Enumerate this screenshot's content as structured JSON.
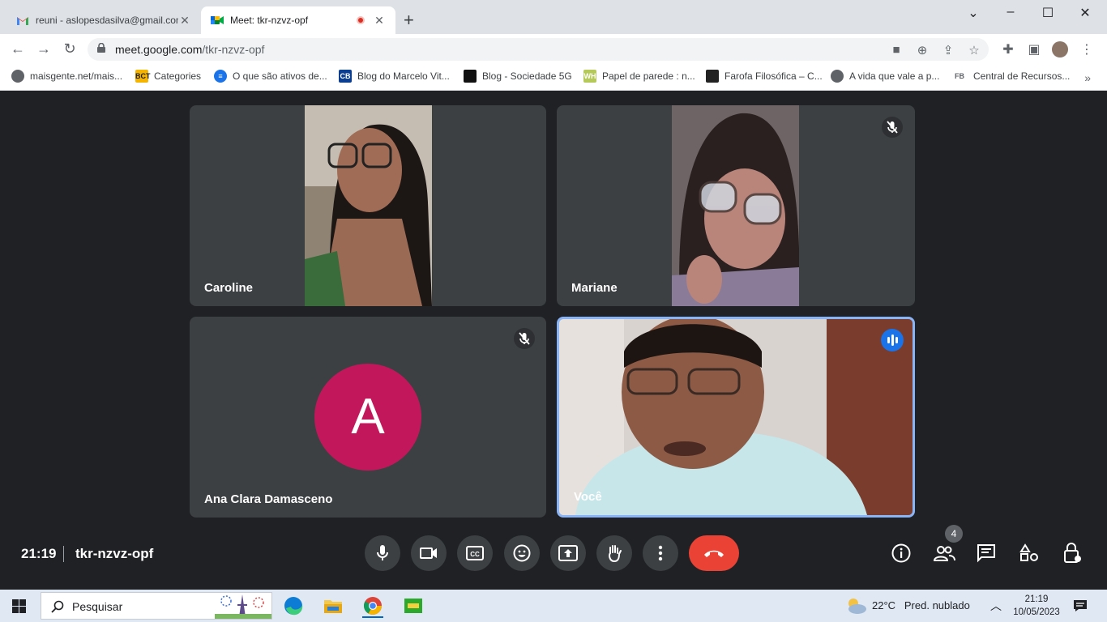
{
  "browser": {
    "tabs": [
      {
        "title": "reuni - aslopesdasilva@gmail.com",
        "active": false
      },
      {
        "title": "Meet: tkr-nzvz-opf",
        "active": true
      }
    ],
    "url_host": "meet.google.com",
    "url_path": "/tkr-nzvz-opf",
    "bookmarks": [
      {
        "label": "maisgente.net/mais...",
        "icon": "globe-icon"
      },
      {
        "label": "Categories",
        "icon": "bct-icon"
      },
      {
        "label": "O que são ativos de...",
        "icon": "doc-icon"
      },
      {
        "label": "Blog do Marcelo Vit...",
        "icon": "cb-icon"
      },
      {
        "label": "Blog - Sociedade 5G",
        "icon": "sociedade-icon"
      },
      {
        "label": "Papel de parede : n...",
        "icon": "wh-icon"
      },
      {
        "label": "Farofa Filosófica – C...",
        "icon": "farofa-icon"
      },
      {
        "label": "A vida que vale a p...",
        "icon": "globe-icon"
      },
      {
        "label": "Central de Recursos...",
        "icon": "fb-icon"
      }
    ],
    "bookmarks_more": "»"
  },
  "meet": {
    "participants": [
      {
        "name": "Caroline",
        "muted": false,
        "camera": true
      },
      {
        "name": "Mariane",
        "muted": true,
        "camera": true
      },
      {
        "name": "Ana Clara Damasceno",
        "muted": true,
        "camera": false,
        "avatar_letter": "A",
        "avatar_color": "#c2185b"
      },
      {
        "name": "Você",
        "speaking": true,
        "camera": true
      }
    ],
    "time": "21:19",
    "meeting_code": "tkr-nzvz-opf",
    "participant_count": "4",
    "controls": [
      "mic-icon",
      "camera-icon",
      "captions-icon",
      "emoji-icon",
      "present-icon",
      "raise-hand-icon",
      "more-options-icon",
      "end-call-icon"
    ],
    "side_controls": [
      "info-icon",
      "people-icon",
      "chat-icon",
      "activities-icon",
      "host-controls-icon"
    ],
    "colors": {
      "background": "#202124",
      "tile": "#3c4043",
      "end_call": "#ea4335",
      "speaking": "#1a73e8"
    }
  },
  "taskbar": {
    "search_placeholder": "Pesquisar",
    "weather_temp": "22°C",
    "weather_desc": "Pred. nublado",
    "time": "21:19",
    "date": "10/05/2023"
  }
}
